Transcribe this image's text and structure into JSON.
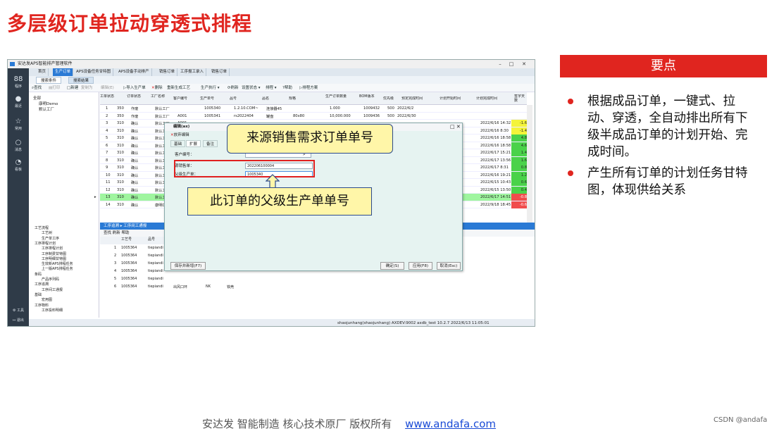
{
  "slide": {
    "title": "多层级订单拉动穿透式排程"
  },
  "app": {
    "title": "安达发APS智能排产管理软件",
    "tabs": [
      "首页",
      "生产订单",
      "APS设备任务甘特图",
      "APS设备手动排产",
      "销售订单",
      "工序报工录入",
      "销售订单"
    ],
    "subtabs": [
      "搜索条件",
      "搜索结果"
    ],
    "toolbar": [
      "查找",
      "打印",
      "新建",
      "复制为",
      "编辑(E)",
      "导入生产单",
      "删除",
      "重新生成工艺",
      "生产执行",
      "刷新",
      "设置状态",
      "排程",
      "帮助",
      "排程方案"
    ],
    "nav": [
      {
        "icon": "88",
        "label": "程序"
      },
      {
        "icon": "●",
        "label": "最近"
      },
      {
        "icon": "☆",
        "label": "常用"
      },
      {
        "icon": "○",
        "label": "消息"
      },
      {
        "icon": "◔",
        "label": "看板"
      }
    ],
    "nav_bottom": [
      "工具",
      "退出"
    ],
    "tree": [
      "全部",
      "康明Demo",
      "默认工厂"
    ],
    "grid_headers": [
      "工单状态",
      "订单状态",
      "工厂名称",
      "客户编号",
      "生产单号",
      "品号",
      "品名",
      "规格",
      "生产订单数量",
      "BOM版本",
      "优先级",
      "预定完成时间",
      "计划开始时间",
      "计划完成时间",
      "签字天数"
    ],
    "rows": [
      {
        "no": "1",
        "a": "350",
        "b": "作废",
        "c": "默认工厂",
        "d": "",
        "e": "1005340",
        "f": "1.2.10.COM~",
        "g": "连接器45",
        "h": "",
        "q": "1.000",
        "bom": "1009432",
        "pri": "500",
        "due": "2022/6/2",
        "ps": "",
        "pe": "",
        "delay": ""
      },
      {
        "no": "2",
        "a": "350",
        "b": "作废",
        "c": "默认工厂",
        "d": "A001",
        "e": "1005341",
        "f": "rs2022404",
        "g": "罐盘",
        "h": "80x80",
        "q": "10,000.000",
        "bom": "1009436",
        "pri": "500",
        "due": "2022/6/30",
        "ps": "",
        "pe": "",
        "delay": ""
      },
      {
        "no": "3",
        "a": "310",
        "b": "确认",
        "c": "默认工厂",
        "d": "A001",
        "e": "",
        "f": "",
        "g": "",
        "h": "",
        "q": "",
        "bom": "",
        "pri": "",
        "due": "",
        "ps": "",
        "pe": "2022/6/16 14:32",
        "delay": "-1.6"
      },
      {
        "no": "4",
        "a": "310",
        "b": "确认",
        "c": "默认工厂",
        "d": "A",
        "e": "",
        "f": "",
        "g": "",
        "h": "",
        "q": "",
        "bom": "",
        "pri": "",
        "due": "",
        "ps": "",
        "pe": "2022/6/16 8:30",
        "delay": "-1.4"
      },
      {
        "no": "5",
        "a": "310",
        "b": "确认",
        "c": "默认工厂",
        "d": "A",
        "e": "",
        "f": "",
        "g": "",
        "h": "",
        "q": "",
        "bom": "",
        "pri": "",
        "due": "",
        "ps": "",
        "pe": "2022/6/16 18:58",
        "delay": "4.8"
      },
      {
        "no": "6",
        "a": "310",
        "b": "确认",
        "c": "默认工厂",
        "d": "A",
        "e": "",
        "f": "",
        "g": "",
        "h": "",
        "q": "",
        "bom": "",
        "pri": "",
        "due": "",
        "ps": "",
        "pe": "2022/6/16 18:58",
        "delay": "4.6"
      },
      {
        "no": "7",
        "a": "310",
        "b": "确认",
        "c": "默认工厂",
        "d": "A",
        "e": "",
        "f": "",
        "g": "",
        "h": "",
        "q": "",
        "bom": "",
        "pri": "",
        "due": "",
        "ps": "",
        "pe": "2022/6/17 15:21",
        "delay": "1.4"
      },
      {
        "no": "8",
        "a": "310",
        "b": "确认",
        "c": "默认工厂",
        "d": "A",
        "e": "",
        "f": "",
        "g": "",
        "h": "",
        "q": "",
        "bom": "",
        "pri": "",
        "due": "",
        "ps": "",
        "pe": "2022/6/17 13:56",
        "delay": "1.6"
      },
      {
        "no": "9",
        "a": "310",
        "b": "确认",
        "c": "默认工厂",
        "d": "A",
        "e": "",
        "f": "",
        "g": "",
        "h": "",
        "q": "",
        "bom": "",
        "pri": "",
        "due": "",
        "ps": "",
        "pe": "2022/6/17 8:31",
        "delay": "0.8"
      },
      {
        "no": "10",
        "a": "310",
        "b": "确认",
        "c": "默认工厂",
        "d": "A",
        "e": "",
        "f": "",
        "g": "",
        "h": "",
        "q": "",
        "bom": "",
        "pri": "",
        "due": "",
        "ps": "",
        "pe": "2022/6/16 19:21",
        "delay": "1.2"
      },
      {
        "no": "11",
        "a": "310",
        "b": "确认",
        "c": "默认工厂",
        "d": "A",
        "e": "",
        "f": "",
        "g": "",
        "h": "",
        "q": "",
        "bom": "",
        "pri": "",
        "due": "",
        "ps": "",
        "pe": "2022/6/15 10:43",
        "delay": "0.6"
      },
      {
        "no": "12",
        "a": "310",
        "b": "确认",
        "c": "默认工厂",
        "d": "A",
        "e": "",
        "f": "",
        "g": "",
        "h": "",
        "q": "",
        "bom": "",
        "pri": "",
        "due": "",
        "ps": "",
        "pe": "2022/6/15 13:50",
        "delay": "0.4"
      },
      {
        "no": "13",
        "a": "310",
        "b": "确认",
        "c": "默认工厂",
        "d": "A",
        "e": "",
        "f": "",
        "g": "",
        "h": "",
        "q": "",
        "bom": "",
        "pri": "",
        "due": "",
        "ps": "",
        "pe": "2022/6/17 14:51",
        "delay": "-0.8"
      },
      {
        "no": "14",
        "a": "310",
        "b": "确认",
        "c": "康明Demo",
        "d": "",
        "e": "",
        "f": "",
        "g": "",
        "h": "",
        "q": "",
        "bom": "",
        "pri": "",
        "due": "",
        "ps": "",
        "pe": "2022/9/18 18:45",
        "delay": "-0.6"
      }
    ],
    "lower_tree": [
      "工艺流程",
      "工艺树",
      "生产单工序",
      "工序排程计划",
      "工序排程计划",
      "工序制费甘特图",
      "工序明细甘特图",
      "生效新APS排程任务",
      "上一版APS排程任务",
      "条码",
      "产品序列码",
      "工序追溯",
      "工序间工通报",
      "基础",
      "宏用图",
      "工序物料",
      "工序投料明细"
    ],
    "lower_header": "工序追溯 ▸ 工序间工通报",
    "lower_toolbar": "查找  刷新  帮助",
    "lower_cols": [
      "工艺号",
      "品号"
    ],
    "lower_rows": [
      {
        "n": "1",
        "a": "1005364",
        "b": "tiepiandi"
      },
      {
        "n": "2",
        "a": "1005364",
        "b": "tiepiandi"
      },
      {
        "n": "3",
        "a": "1005364",
        "b": "tiepiandi"
      },
      {
        "n": "4",
        "a": "1005364",
        "b": "tiepiandi"
      },
      {
        "n": "5",
        "a": "1005364",
        "b": "tiepiandi"
      },
      {
        "n": "6",
        "a": "1005364",
        "b": "tiepiandi",
        "c": "出风口环",
        "d": "NK",
        "e": "铁壳"
      }
    ],
    "status": "shaojunhang(shaojunhang)  AXDEV:9002  axdb_test  10.2.7  2022/6/13 11:05:01"
  },
  "dialog": {
    "title": "编辑(ax)",
    "save": "放弃编辑",
    "tabs": [
      "基础",
      "扩展",
      "备注"
    ],
    "field_customer": "客户编号：",
    "field_customer_val": "",
    "field_source": "源销售单：",
    "field_source_val": "202206100004",
    "field_parent": "父级生产单：",
    "field_parent_val": "1005340",
    "btn_savenew": "保存并新增(F7)",
    "btn_ok": "确定(S)",
    "btn_apply": "应用(F8)",
    "btn_cancel": "取消(Esc)"
  },
  "callouts": {
    "top": "来源销售需求订单单号",
    "bottom": "此订单的父级生产单单号"
  },
  "points": {
    "header": "要点",
    "items": [
      "根据成品订单，一键式、拉动、穿透，全自动排出所有下级半成品订单的计划开始、完成时间。",
      "产生所有订单的计划任务甘特图，体现供给关系"
    ]
  },
  "footer": {
    "text": "安达发  智能制造 核心技术原厂  版权所有",
    "link": "www.andafa.com"
  },
  "watermark": "CSDN @andafa",
  "colors": {
    "accent": "#e0251f",
    "app_blue": "#2a7ad5",
    "callout_fill": "#fff6a8"
  }
}
